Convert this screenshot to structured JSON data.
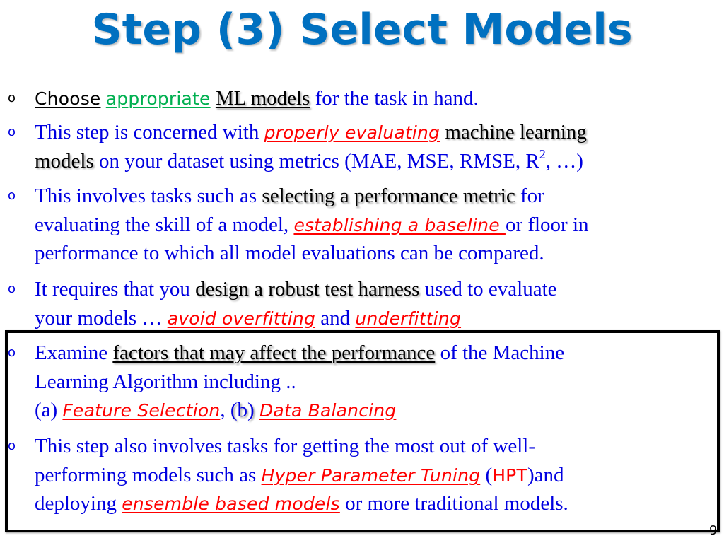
{
  "slide": {
    "title": "Step (3) Select Models",
    "page_number": "9",
    "colors": {
      "title": "#0070c0",
      "body_text": "#0000e0",
      "emphasis_red": "#ff0000",
      "emphasis_green": "#00b050",
      "emphasis_black": "#000000"
    },
    "bullets": [
      {
        "marker": "o",
        "lines": [
          {
            "choose": "Choose",
            "appropriate": "appropriate",
            "ml_models": "ML models",
            "rest": " for the task in hand."
          }
        ]
      },
      {
        "marker": "o",
        "line1": {
          "text1": "This step is concerned with ",
          "em1": "properly evaluating",
          "space": " ",
          "black1": "machine learning"
        },
        "line2": {
          "black2": "models",
          "text2": " on your dataset using metrics (MAE, MSE, RMSE, R",
          "sup": "2",
          "text3": ", …)"
        }
      },
      {
        "marker": "o",
        "line1": {
          "text1": "This involves tasks such as ",
          "black1": "selecting a performance metric",
          "text2": " for"
        },
        "line2": {
          "text1": "evaluating the skill of a model, ",
          "em1": "establishing a baseline ",
          "text2": "or floor in"
        },
        "line3": {
          "text1": "performance to which all model evaluations can be compared."
        }
      },
      {
        "marker": "o",
        "line1": {
          "text1": "It requires that you ",
          "black1": "design a robust test harness",
          "text2": " used to evaluate"
        },
        "line2": {
          "text1": "your models … ",
          "em1": "avoid overfitting",
          "text2": " and ",
          "em2": "underfitting"
        }
      },
      {
        "marker": "o",
        "line1": {
          "text1": "Examine ",
          "black1": "factors that may affect the performance",
          "text2": " of the Machine"
        },
        "line2": {
          "text1": "Learning Algorithm including .."
        },
        "line3": {
          "text1": "(a) ",
          "em1": "Feature Selection",
          "comma": ", ",
          "b": "(b)",
          "space": " ",
          "em2": "Data Balancing"
        }
      },
      {
        "marker": "o",
        "line1": {
          "text1": "This step also involves tasks for getting the most out of well-"
        },
        "line2": {
          "text1": "performing models such as ",
          "em1": "Hyper Parameter Tuning",
          "text2": " (",
          "hpt": "HPT",
          "text3": ")and"
        },
        "line3": {
          "text1": "deploying ",
          "em1": "ensemble based models",
          "text2": " or more traditional models."
        }
      }
    ]
  }
}
